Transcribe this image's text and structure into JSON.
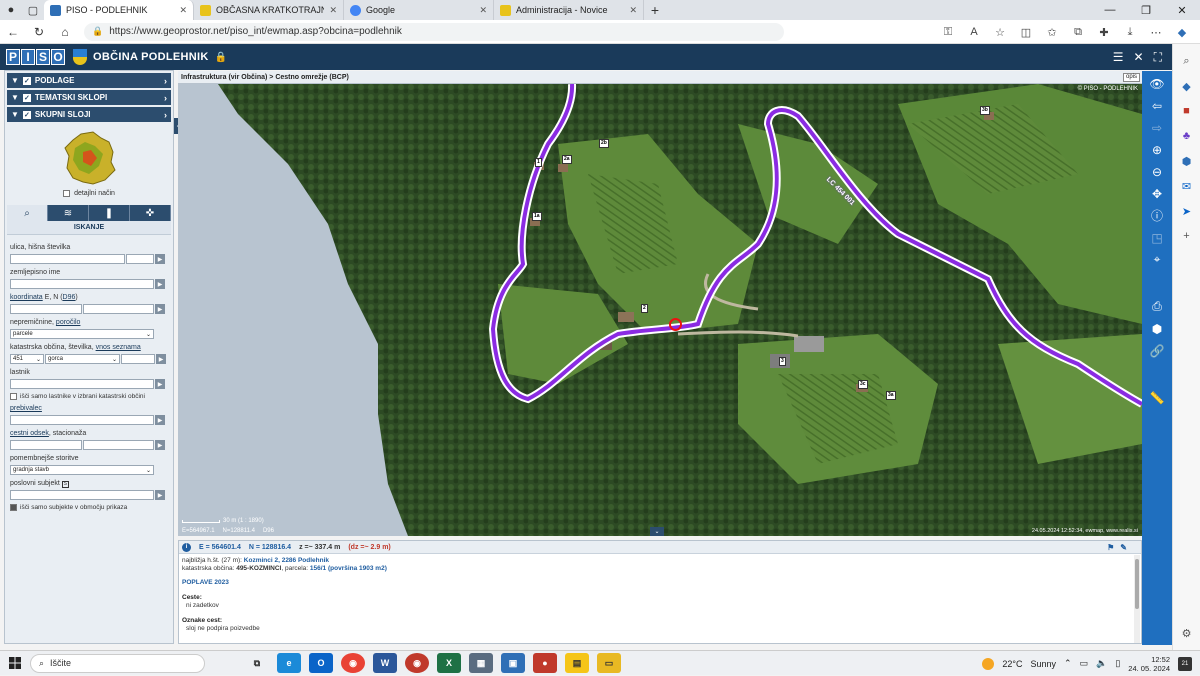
{
  "browser": {
    "tabs": [
      {
        "label": "PISO - PODLEHNIK",
        "active": true,
        "color": "#2f6fb6"
      },
      {
        "label": "OBČASNA KRATKOTRAJNA POP",
        "active": false,
        "color": "#e8c31c"
      },
      {
        "label": "Google",
        "active": false,
        "color": "#4285f4"
      },
      {
        "label": "Administracija - Novice",
        "active": false,
        "color": "#e8c31c"
      }
    ],
    "url": "https://www.geoprostor.net/piso_int/ewmap.asp?obcina=podlehnik"
  },
  "app": {
    "title": "OBČINA PODLEHNIK",
    "logo_letters": [
      "P",
      "I",
      "S",
      "O"
    ]
  },
  "sidebar": {
    "layers": [
      {
        "label": "PODLAGE"
      },
      {
        "label": "TEMATSKI SKLOPI"
      },
      {
        "label": "SKUPNI SLOJI"
      }
    ],
    "detail_mode_label": "detajlni način",
    "panel_title": "ISKANJE",
    "fields": {
      "street_label": "ulica, hišna številka",
      "geo_name_label": "zemljepisno ime",
      "coord_label_link": "koordinata",
      "coord_label_mid": " E, N (",
      "coord_label_d96": "D96",
      "coord_label_end": ")",
      "property_label": "nepremičnine, ",
      "property_link": "poročilo",
      "property_select": "parcele",
      "cadastral_label": "katastrska občina, številka, ",
      "cadastral_link": "vnos seznama",
      "cadastral_num": "451",
      "cadastral_name": "gorca",
      "owner_label": "lastnik",
      "owner_check_label": "išči samo lastnike v izbrani katastrski občini",
      "resident_label": "prebivalec",
      "road_label_link": "cestni odsek",
      "road_label_end": ", stacionaža",
      "services_label": "pomembnejše storitve",
      "services_select": "gradnja stavb",
      "business_label": "poslovni subjekt",
      "business_check_label": "išči samo subjekte v območju prikaza"
    }
  },
  "map": {
    "breadcrumb": "Infrastruktura (vir Občina) > Cestno omrežje (BCP)",
    "opis_label": "opis",
    "copyright": "© PISO - PODLEHNIK",
    "timestamp": "24.05.2024 12:52:34, ewmap, www.realis.si",
    "scale_text": "30 m   (1 : 1890)",
    "cursor_e": "E=564967.1",
    "cursor_n": "N=128811.4",
    "cursor_crs": "D96",
    "road_label": "LC 454 001",
    "house_numbers": [
      "1",
      "2a",
      "2b",
      "1a",
      "2",
      "3",
      "3c",
      "3a",
      "3b"
    ],
    "colors": {
      "road": "#8a2be2",
      "forest": "#2d4a24",
      "meadow": "#5e8a3a",
      "mask": "#b8c4d0"
    }
  },
  "info": {
    "e_value": "E = 564601.4",
    "n_value": "N = 128816.4",
    "z_value": "z =~ 337.4 m",
    "dz_value": "(dz =~ 2.9 m)",
    "nearest_prefix": "najbližja h.št. (27 m): ",
    "nearest_value": "Kozminci 2, 2286 Podlehnik",
    "cadastral_prefix": "katastrska občina: ",
    "cadastral_value": "495-KOZMINCI",
    "parcel_prefix": ", parcela: ",
    "parcel_value": "156/1 (površina 1903 m2)",
    "floods_title": "POPLAVE 2023",
    "roads_title": "Ceste:",
    "roads_value": "ni zadetkov",
    "road_marks_title": "Oznake cest:",
    "road_marks_value": "sloj ne podpira poizvedbe"
  },
  "taskbar": {
    "search_placeholder": "Iščite",
    "weather_temp": "22°C",
    "weather_text": "Sunny",
    "time": "12:52",
    "date": "24. 05. 2024",
    "notifications": "21"
  }
}
